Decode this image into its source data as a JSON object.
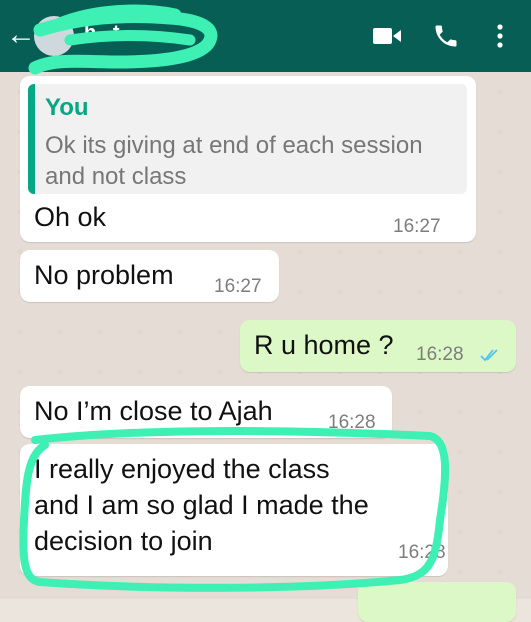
{
  "header": {
    "contact_name": "h.   .t",
    "back_icon": "arrow-left-icon",
    "icons": [
      "video-camera-icon",
      "phone-icon",
      "more-vertical-icon"
    ]
  },
  "colors": {
    "header_bg": "#075e54",
    "incoming_bubble": "#ffffff",
    "outgoing_bubble": "#dcf8c6",
    "quote_accent": "#06a884",
    "highlight_scribble": "#3ef0b4",
    "read_ticks": "#4fc3f7"
  },
  "messages": [
    {
      "direction": "in",
      "quoted": {
        "author": "You",
        "text": "Ok its giving at end of each session and not class"
      },
      "text": "Oh ok",
      "time": "16:27"
    },
    {
      "direction": "in",
      "text": "No problem",
      "time": "16:27"
    },
    {
      "direction": "out",
      "text": "R u home ?",
      "time": "16:28",
      "status": "read"
    },
    {
      "direction": "in",
      "text": "No I’m close to Ajah",
      "time": "16:28"
    },
    {
      "direction": "in",
      "lines": [
        "I really enjoyed the class",
        "and I am so glad I made the",
        "decision to join"
      ],
      "time": "16:28"
    }
  ]
}
